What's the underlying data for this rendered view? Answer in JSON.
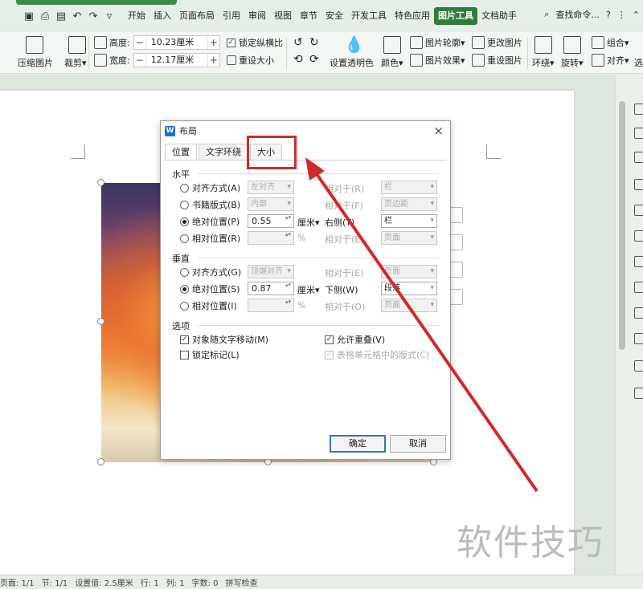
{
  "menubar": {
    "tabs": [
      "开始",
      "插入",
      "页面布局",
      "引用",
      "审阅",
      "视图",
      "章节",
      "安全",
      "开发工具",
      "特色应用",
      "图片工具",
      "文档助手"
    ],
    "active_tab": "图片工具",
    "search": "查找命令..."
  },
  "ribbon": {
    "compress": "压缩图片",
    "crop": "裁剪",
    "height_label": "高度:",
    "height_value": "10.23厘米",
    "width_label": "宽度:",
    "width_value": "12.17厘米",
    "lock_ratio": "锁定纵横比",
    "reset_size": "重设大小",
    "transparent": "设置透明色",
    "color": "颜色",
    "outline": "图片轮廓",
    "effects": "图片效果",
    "change_pic": "更改图片",
    "reset_pic": "重设图片",
    "wrap": "环绕",
    "rotate": "旋转",
    "group": "组合",
    "align": "对齐",
    "select": "选"
  },
  "dialog": {
    "title": "布局",
    "close": "×",
    "tabs": [
      "位置",
      "文字环绕",
      "大小"
    ],
    "horizontal": {
      "section": "水平",
      "align_label": "对齐方式(A)",
      "align_value": "左对齐",
      "align_rel_label": "相对于(R)",
      "align_rel_value": "栏",
      "book_label": "书籍版式(B)",
      "book_value": "内部",
      "book_rel_label": "相对于(F)",
      "book_rel_value": "页边距",
      "abs_label": "绝对位置(P)",
      "abs_value": "0.55",
      "abs_unit": "厘米▾",
      "abs_rel_label": "右侧(T)",
      "abs_rel_value": "栏",
      "rel_label": "相对位置(R)",
      "rel_unit": "%",
      "rel_rel_label": "相对于(E)",
      "rel_rel_value": "页面"
    },
    "vertical": {
      "section": "垂直",
      "align_label": "对齐方式(G)",
      "align_value": "顶端对齐",
      "align_rel_label": "相对于(E)",
      "align_rel_value": "页面",
      "abs_label": "绝对位置(S)",
      "abs_value": "0.87",
      "abs_unit": "厘米▾",
      "abs_rel_label": "下侧(W)",
      "abs_rel_value": "段落",
      "rel_label": "相对位置(I)",
      "rel_unit": "%",
      "rel_rel_label": "相对于(O)",
      "rel_rel_value": "页面"
    },
    "options": {
      "section": "选项",
      "move_with_text": "对象随文字移动(M)",
      "allow_overlap": "允许重叠(V)",
      "lock_anchor": "锁定标记(L)",
      "table_layout": "表格单元格中的版式(C)"
    },
    "ok": "确定",
    "cancel": "取消"
  },
  "status": {
    "page": "页面: 1/1",
    "section": "节: 1/1",
    "setting": "设置值: 2.5厘米",
    "row": "行: 1",
    "col": "列: 1",
    "chars": "字数: 0",
    "spell": "拼写检查"
  },
  "watermark": "软件技巧",
  "colors": {
    "accent": "#2e7d3a",
    "highlight": "#d12a2a"
  }
}
